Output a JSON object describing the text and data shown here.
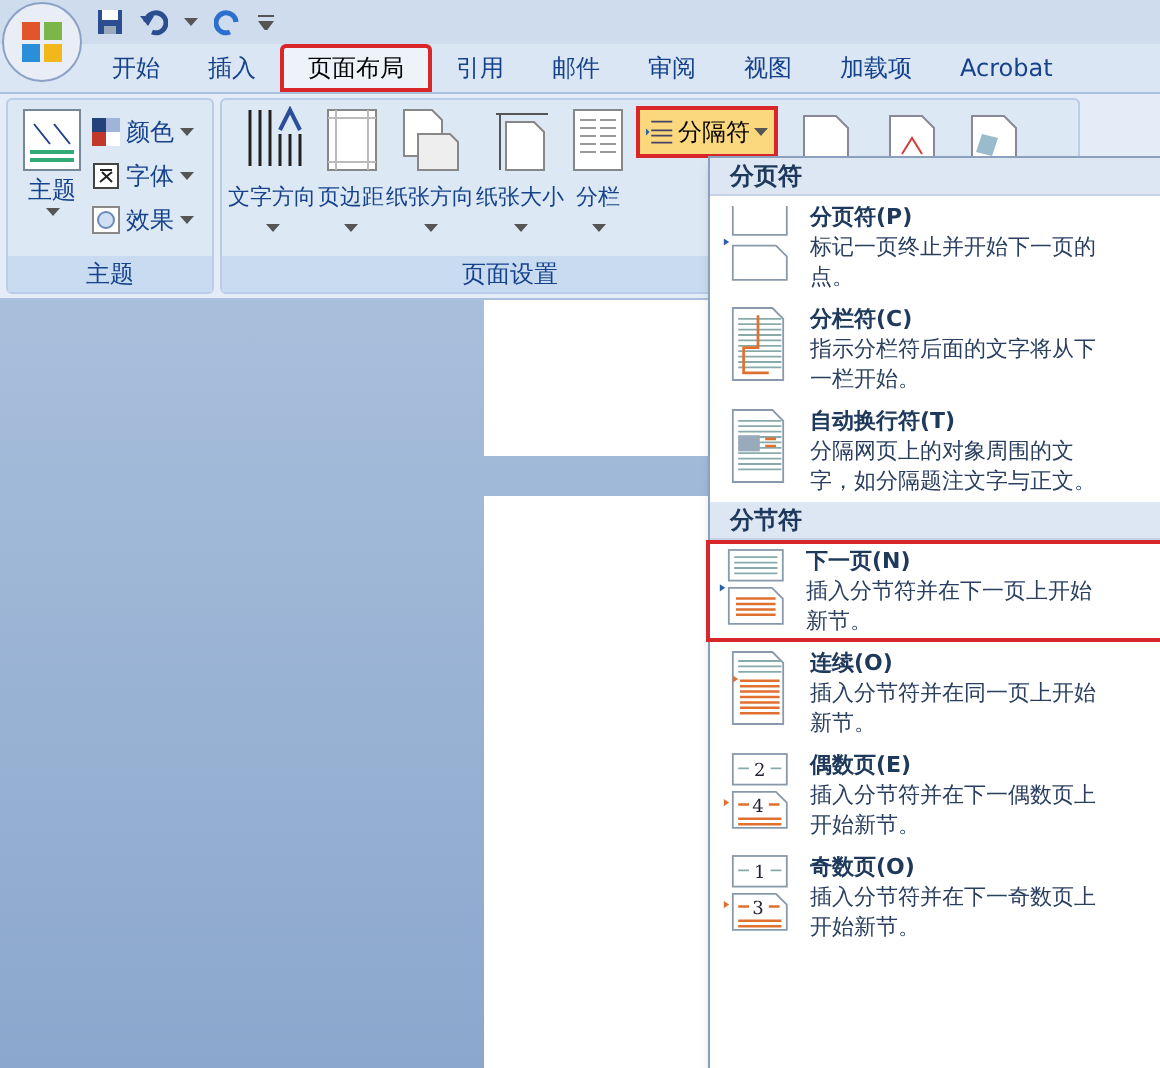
{
  "tabs": [
    {
      "label": "开始",
      "selected": false
    },
    {
      "label": "插入",
      "selected": false
    },
    {
      "label": "页面布局",
      "selected": true
    },
    {
      "label": "引用",
      "selected": false
    },
    {
      "label": "邮件",
      "selected": false
    },
    {
      "label": "审阅",
      "selected": false
    },
    {
      "label": "视图",
      "selected": false
    },
    {
      "label": "加载项",
      "selected": false
    },
    {
      "label": "Acrobat",
      "selected": false
    }
  ],
  "theme_group": {
    "label": "主题",
    "main": "主题",
    "options": [
      {
        "kind": "colors",
        "label": "颜色"
      },
      {
        "kind": "fonts",
        "label": "字体"
      },
      {
        "kind": "effects",
        "label": "效果"
      }
    ]
  },
  "page_setup_group": {
    "label": "页面设置",
    "buttons": [
      {
        "kind": "direction",
        "label": "文字方向"
      },
      {
        "kind": "margins",
        "label": "页边距"
      },
      {
        "kind": "orientation",
        "label": "纸张方向"
      },
      {
        "kind": "size",
        "label": "纸张大小"
      },
      {
        "kind": "columns",
        "label": "分栏"
      }
    ],
    "breaks_button": {
      "label": "分隔符",
      "open": true
    }
  },
  "breaks_menu": {
    "sections": [
      {
        "header": "分页符",
        "items": [
          {
            "kind": "page",
            "title": "分页符(P)",
            "description": "标记一页终止并开始下一页的点。",
            "highlighted": false
          },
          {
            "kind": "column",
            "title": "分栏符(C)",
            "description": "指示分栏符后面的文字将从下一栏开始。",
            "highlighted": false
          },
          {
            "kind": "wrap",
            "title": "自动换行符(T)",
            "description": "分隔网页上的对象周围的文字，如分隔题注文字与正文。",
            "highlighted": false
          }
        ]
      },
      {
        "header": "分节符",
        "items": [
          {
            "kind": "next",
            "title": "下一页(N)",
            "description": "插入分节符并在下一页上开始新节。",
            "highlighted": true
          },
          {
            "kind": "continuous",
            "title": "连续(O)",
            "description": "插入分节符并在同一页上开始新节。",
            "highlighted": false
          },
          {
            "kind": "even",
            "title": "偶数页(E)",
            "description": "插入分节符并在下一偶数页上开始新节。",
            "page_numbers": [
              "2",
              "4"
            ],
            "highlighted": false
          },
          {
            "kind": "odd",
            "title": "奇数页(O)",
            "description": "插入分节符并在下一奇数页上开始新节。",
            "page_numbers": [
              "1",
              "3"
            ],
            "highlighted": false
          }
        ]
      }
    ]
  }
}
